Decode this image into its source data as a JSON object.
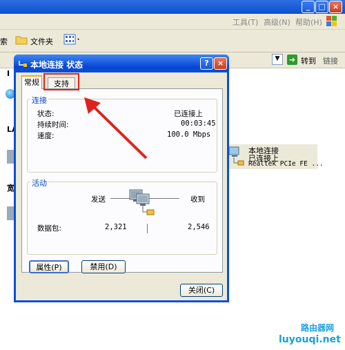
{
  "background": {
    "menu": [
      "工具(T)",
      "高级(N)",
      "帮助(H)"
    ],
    "toolbar": {
      "search_fragment": "索",
      "folders": "文件夹"
    },
    "address": {
      "go": "转到",
      "links": "链接"
    },
    "left_fragments": [
      "I",
      "LA",
      "宽"
    ],
    "connection": {
      "name": "本地连接",
      "status": "已连接上",
      "device": "Realtek PCIe FE ..."
    }
  },
  "dialog": {
    "title": "本地连接 状态",
    "tabs": [
      "常规",
      "支持"
    ],
    "connection_group": {
      "title": "连接",
      "rows": [
        {
          "label": "状态:",
          "value": "已连接上"
        },
        {
          "label": "持续时间:",
          "value": "00:03:45"
        },
        {
          "label": "速度:",
          "value": "100.0 Mbps"
        }
      ]
    },
    "activity_group": {
      "title": "活动",
      "sent_label": "发送",
      "received_label": "收到",
      "packets_label": "数据包:",
      "packets_sent": "2,321",
      "packets_received": "2,546"
    },
    "buttons": {
      "properties": "属性(P)",
      "disable": "禁用(D)",
      "close": "关闭(C)"
    }
  },
  "watermark": {
    "top": "路由器网",
    "bottom": "luyouqi.net"
  },
  "colors": {
    "highlight": "#e0211c",
    "group_title": "#0046d5",
    "titlebar": "#0a4fd6"
  }
}
